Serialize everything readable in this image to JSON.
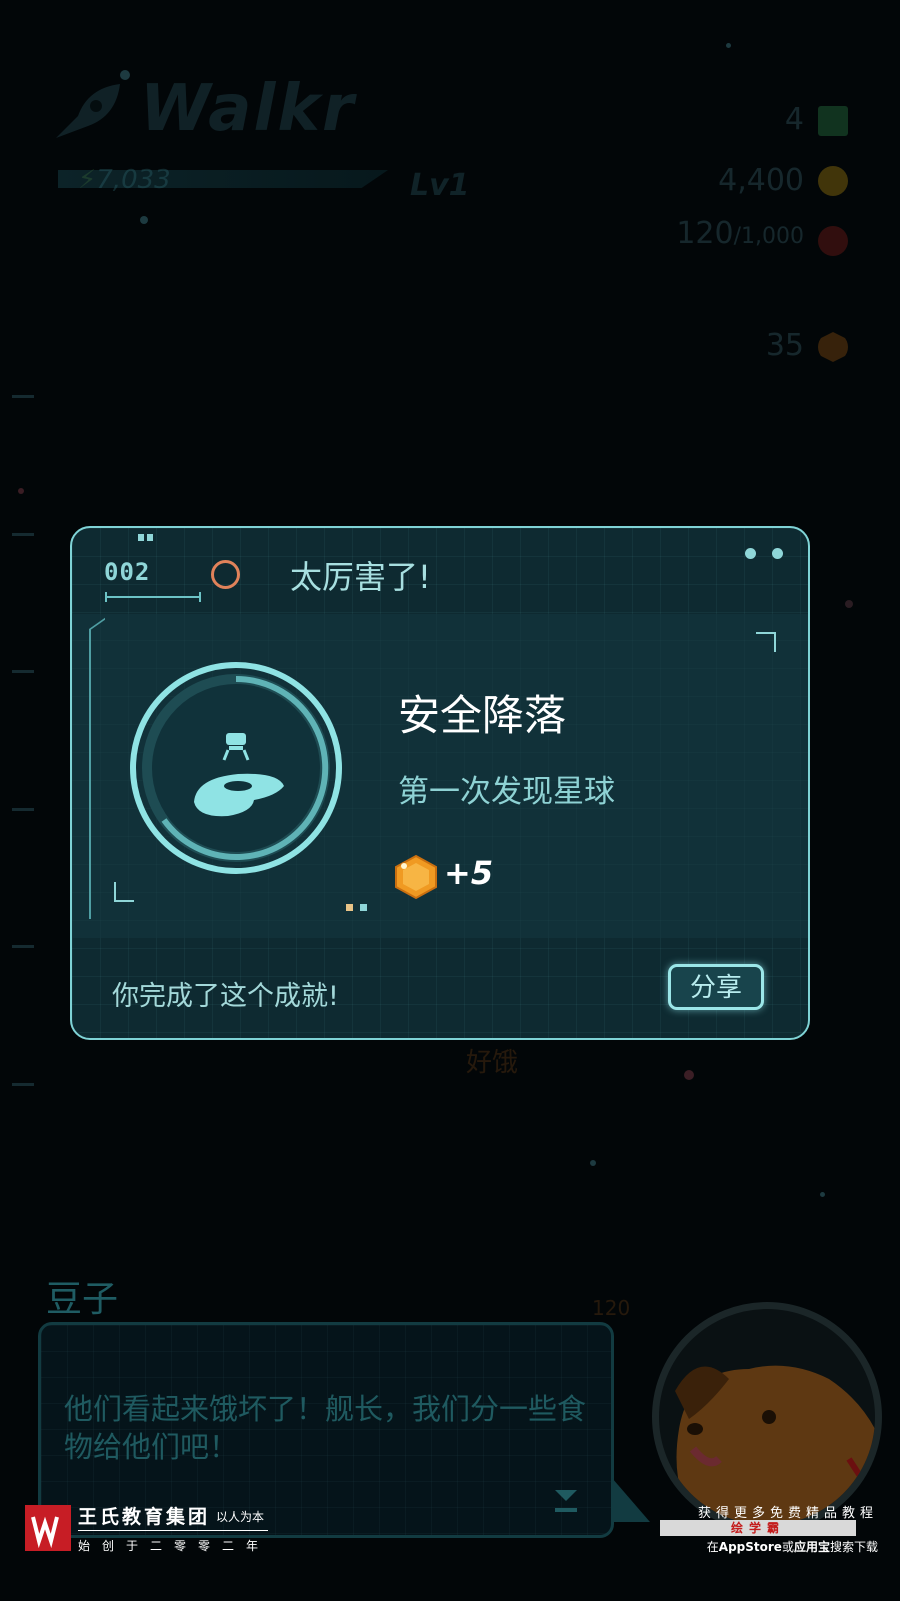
{
  "background_hud": {
    "app_logo": "Walkr",
    "energy": "7,033",
    "level": "Lv1",
    "stats": [
      {
        "value": "4",
        "icon": "green-cubes-icon"
      },
      {
        "value": "4,400",
        "icon": "gold-coin-icon"
      },
      {
        "value": "120",
        "suffix": "/1,000",
        "icon": "tomato-food-icon"
      },
      {
        "value": "35",
        "icon": "orange-hexagon-icon"
      }
    ],
    "ghost_label": "好饿",
    "ghost_food": "120"
  },
  "dialog": {
    "number": "002",
    "title": "太厉害了!",
    "achievement_name": "安全降落",
    "achievement_desc": "第一次发现星球",
    "reward": "+5",
    "reward_icon": "orange-hexagon-icon",
    "footer_text": "你完成了这个成就!",
    "share_label": "分享",
    "accent_color": "#7fd3d6",
    "badge_icon": "landing-pod-icon"
  },
  "conversation": {
    "speaker": "豆子",
    "message": "他们看起来饿坏了！舰长，我们分一些食物给他们吧！",
    "portrait_icon": "dog-astronaut-icon",
    "next_icon": "next-arrow-icon"
  },
  "watermark": {
    "org": "王氏教育集团",
    "slogan": "以人为本",
    "since": "始创于二零零二年",
    "promo": "获得更多免费精品教程",
    "brand": "绘学霸",
    "download_prefix": "在",
    "store1": "AppStore",
    "or": "或",
    "store2": "应用宝",
    "download_suffix": "搜索下载"
  }
}
